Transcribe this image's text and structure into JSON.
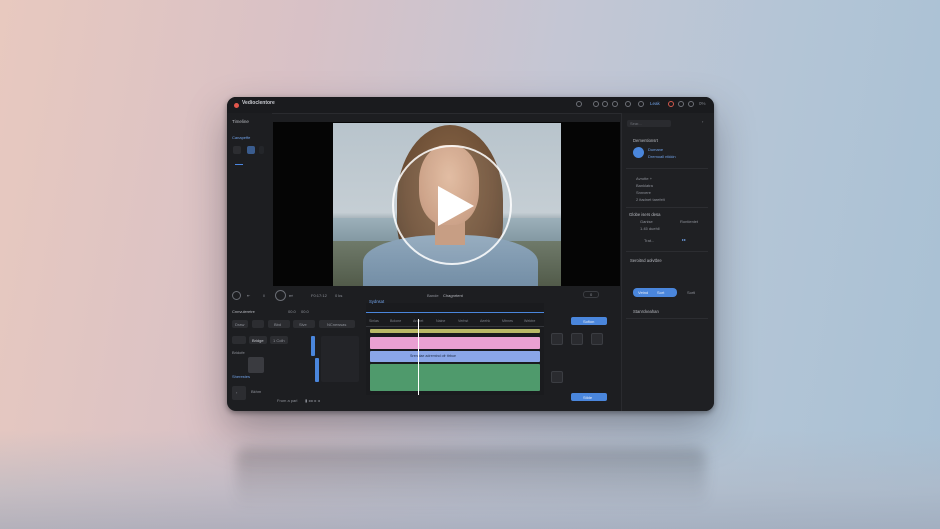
{
  "app": {
    "title": "Vedioclentore"
  },
  "titlebar": {
    "accent_label": "Leak",
    "status": "0%"
  },
  "left_panel": {
    "title": "Timeline",
    "subtitle": "Canapeffe"
  },
  "right_panel": {
    "search_placeholder": "Sear...",
    "section1_title": "Dementionsrt",
    "section1_sub1": "Dumane",
    "section1_sub2": "Dremoall ntkkin",
    "section2_rows": [
      "Avrotte +",
      "Banklatra",
      "Snnvere",
      "2 itadnet tarefelt"
    ],
    "section3_title": "Globe isers desa",
    "section3_rows": [
      "Ganise",
      "1.45 duehll",
      "Trat..."
    ],
    "section3_right": "Rontienlet",
    "section4_title": "Seroitnd aolvtbre",
    "segment": [
      "Vetnd",
      "Sort"
    ],
    "segment_right": "Sortl",
    "section5_title": "Stanrckeahan"
  },
  "transport": {
    "timecode": "F0:17:12",
    "speed": "0 ks",
    "zoom_label": "Bande",
    "track_label": "Chagnrtent",
    "right_value": "0"
  },
  "bottom_left": {
    "title": "Cnnvuleretre",
    "value1": "00.0",
    "value2": "00.0",
    "buttons": [
      "Draw",
      "Bbd",
      "Slve",
      "NCnewsas"
    ],
    "row2": [
      "Bridge",
      "1 Colh"
    ],
    "label_small": "Bridofe",
    "label_blue": "Sherestes",
    "bottom": [
      "Bkhm",
      "Frum a parl"
    ]
  },
  "timeline": {
    "title": "Sydnsat",
    "ruler": [
      "Sinlas",
      "Bolone",
      "Arceet",
      "Naine",
      "Verhst",
      "Aeehk",
      "Mtrnes",
      "Wektre"
    ],
    "clip_label": "Srenolae adremtnd ofr ttrbue"
  },
  "side_buttons": {
    "top": "Sofion",
    "bottom": "Stlde"
  },
  "colors": {
    "accent": "#4a86dc",
    "track_pink": "#e9a0d2",
    "track_blue": "#8aa6e8",
    "track_green": "#4f9a6c",
    "track_yellow": "#b9b866"
  }
}
